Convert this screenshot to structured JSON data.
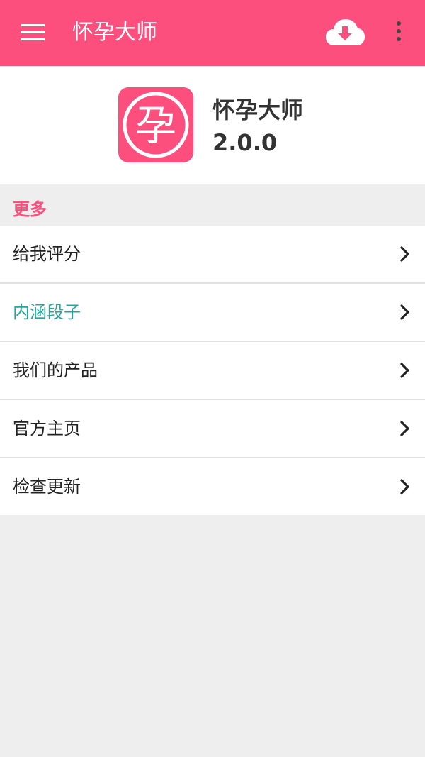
{
  "appbar": {
    "title": "怀孕大师"
  },
  "app_info": {
    "name": "怀孕大师",
    "version": "2.0.0",
    "logo_text": "孕"
  },
  "section": {
    "title": "更多"
  },
  "menu_items": [
    {
      "label": "给我评分"
    },
    {
      "label": "内涵段子",
      "highlighted": true
    },
    {
      "label": "我们的产品"
    },
    {
      "label": "官方主页"
    },
    {
      "label": "检查更新"
    }
  ],
  "colors": {
    "brand": "#fd4f7d",
    "accent": "#26a69a",
    "background": "#eeeeee"
  },
  "icons": {
    "menu": "hamburger-menu-icon",
    "download": "cloud-download-icon",
    "overflow": "more-vertical-icon",
    "chevron": "chevron-right-icon"
  }
}
